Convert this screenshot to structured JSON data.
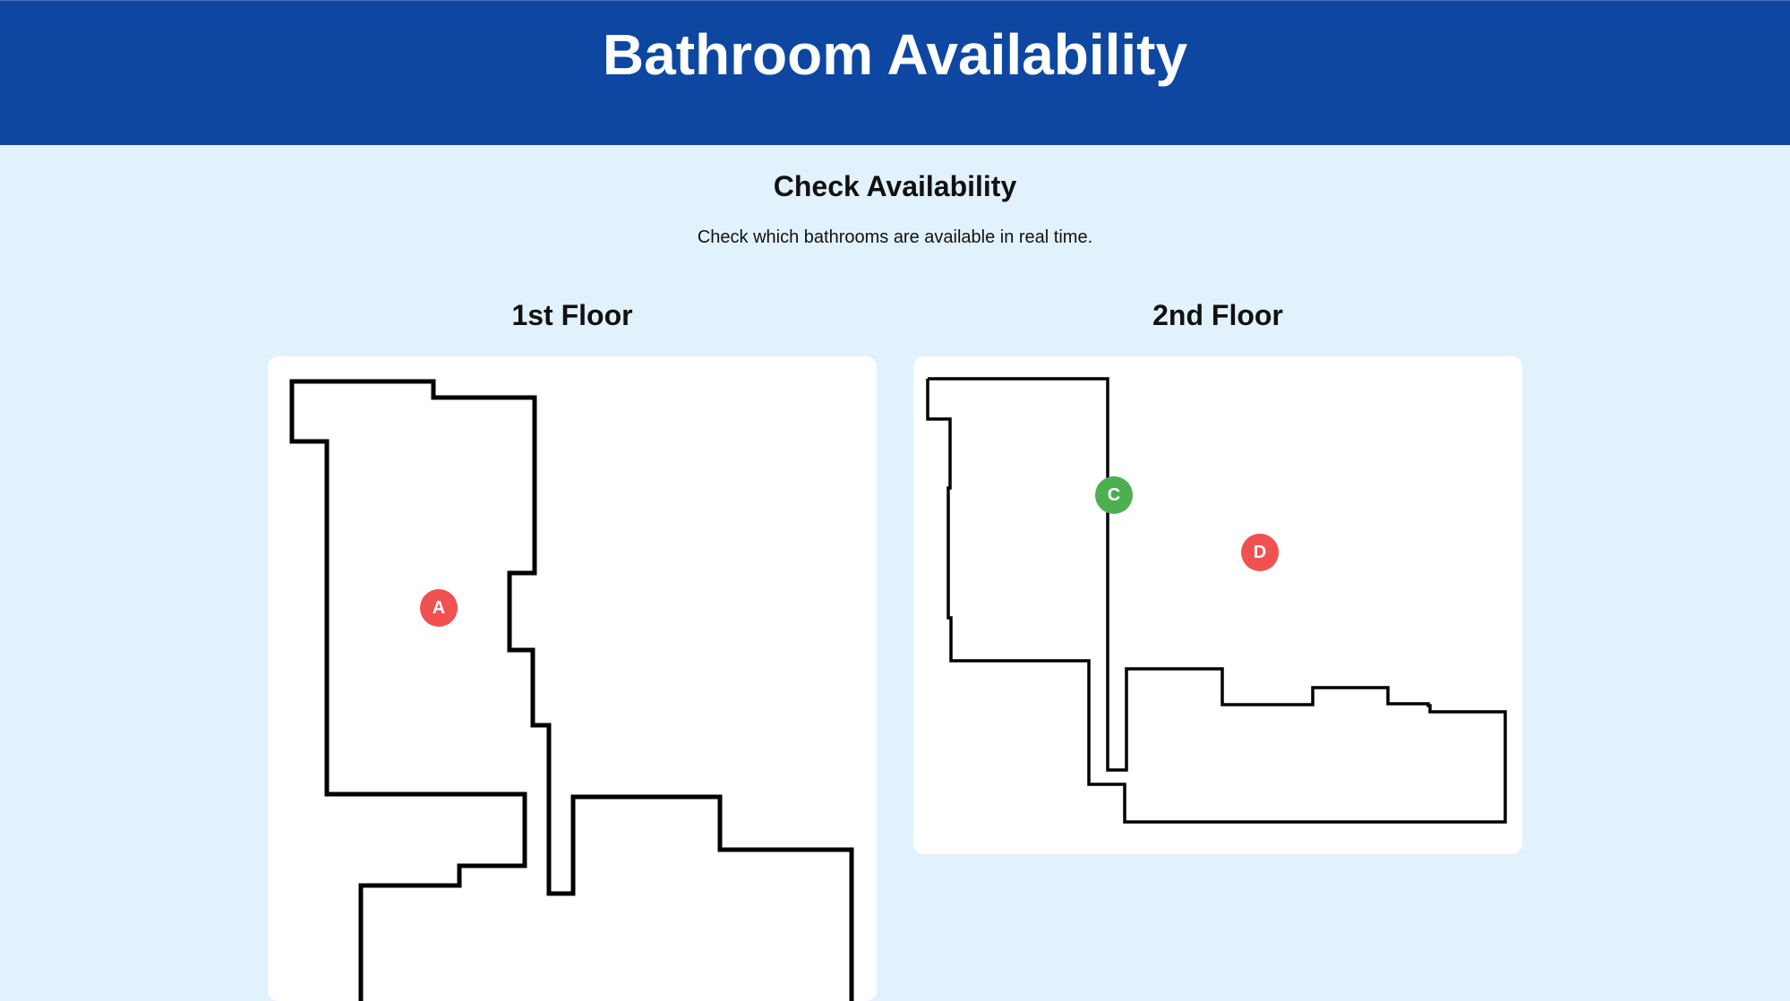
{
  "header": {
    "title": "Bathroom Availability"
  },
  "intro": {
    "heading": "Check Availability",
    "description": "Check which bathrooms are available in real time."
  },
  "floors": [
    {
      "title": "1st Floor",
      "bathrooms": [
        {
          "label": "A",
          "status": "occupied"
        }
      ]
    },
    {
      "title": "2nd Floor",
      "bathrooms": [
        {
          "label": "C",
          "status": "available"
        },
        {
          "label": "D",
          "status": "occupied"
        }
      ]
    }
  ],
  "colors": {
    "header_bg": "#0e47a1",
    "page_bg": "#e2f2fd",
    "available": "#4caf50",
    "occupied": "#f05252"
  }
}
